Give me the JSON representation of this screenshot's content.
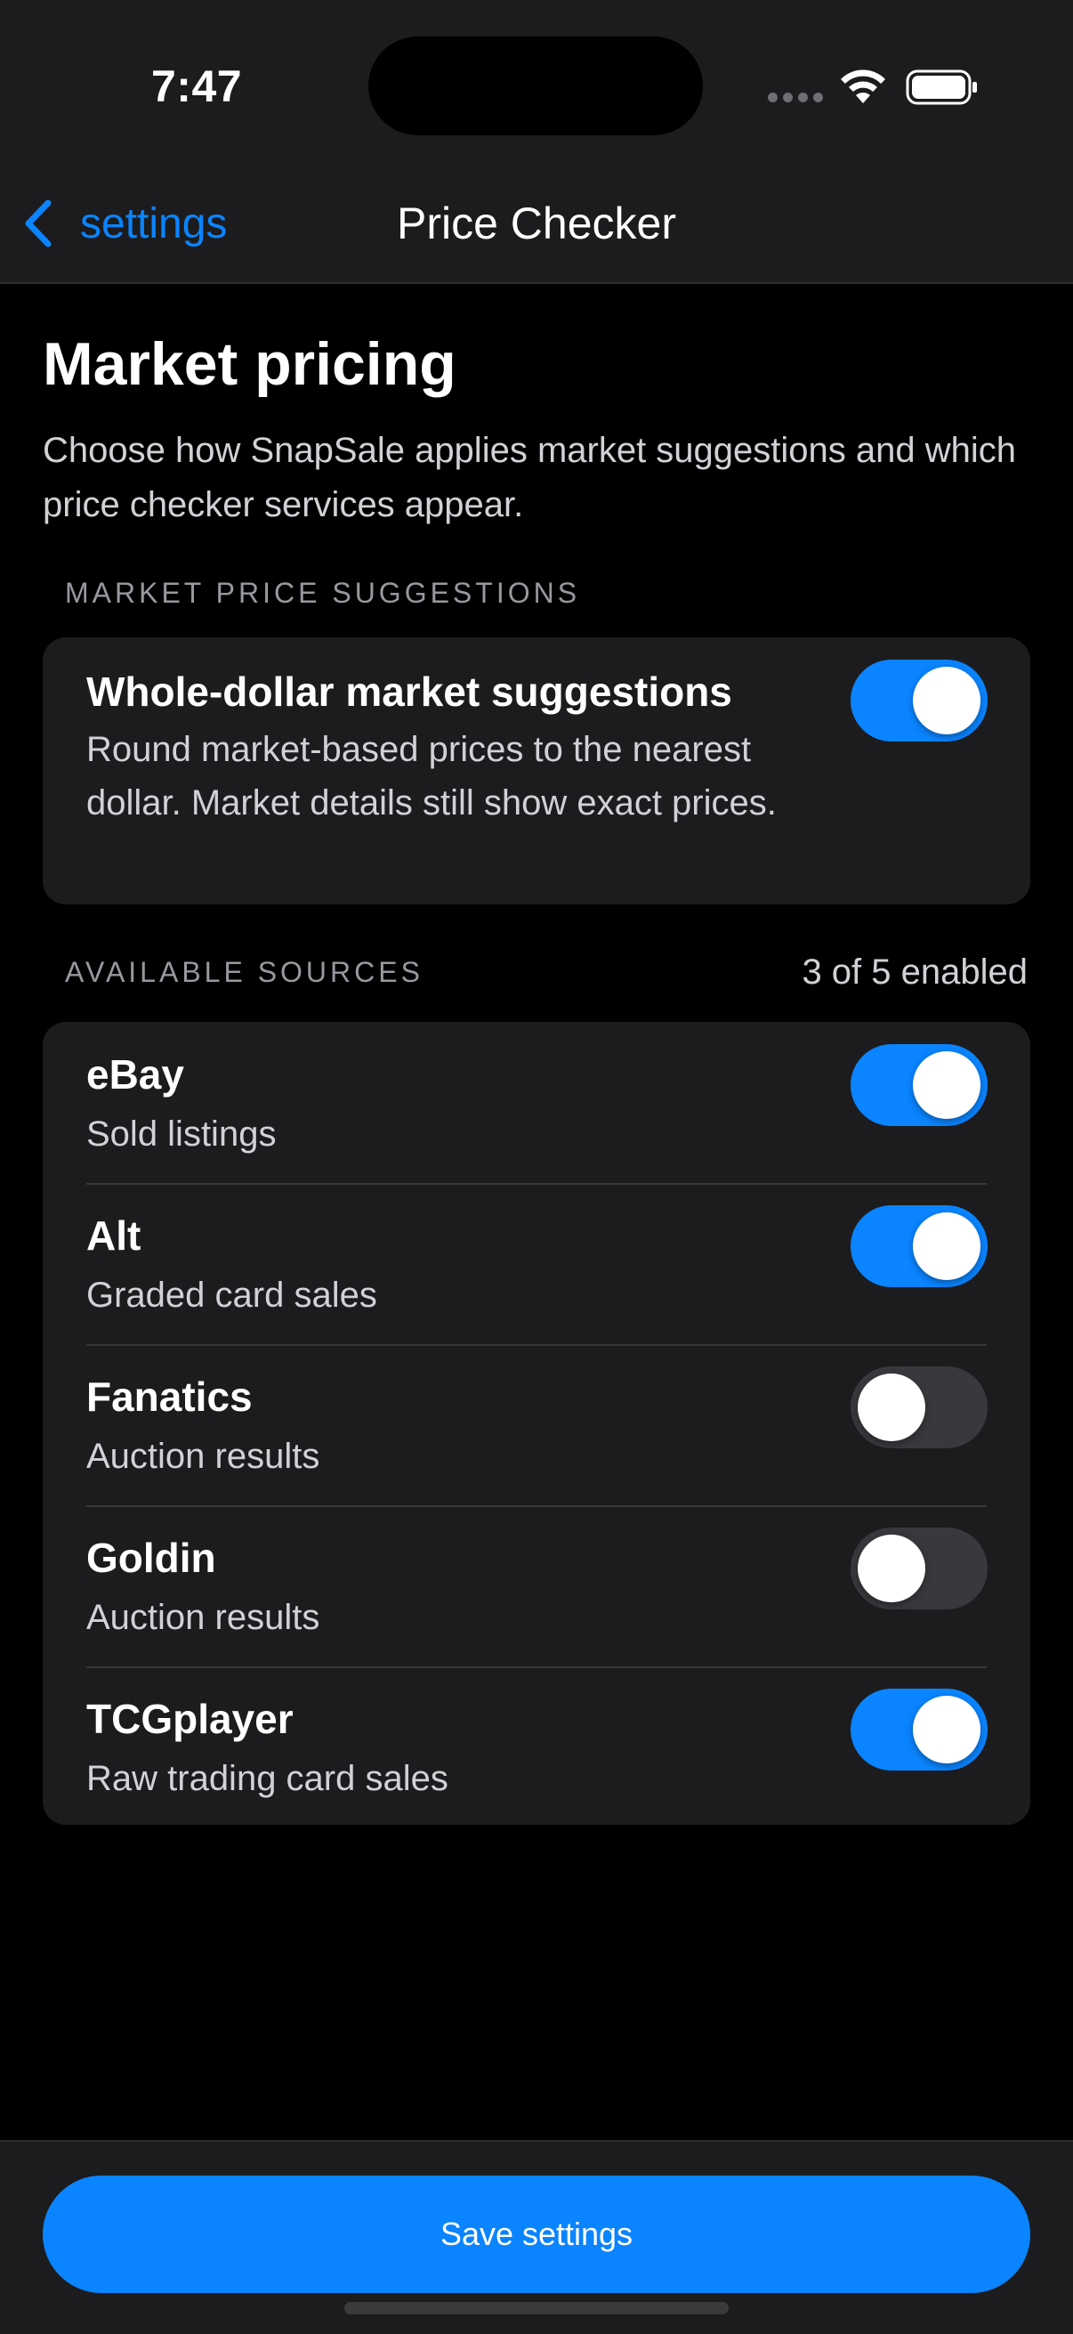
{
  "status_bar": {
    "time": "7:47"
  },
  "nav": {
    "back_label": "settings",
    "title": "Price Checker"
  },
  "page": {
    "title": "Market pricing",
    "description": "Choose how SnapSale applies market suggestions and which price checker services appear."
  },
  "suggestions": {
    "header": "MARKET PRICE SUGGESTIONS",
    "title": "Whole-dollar market suggestions",
    "subtitle": "Round market-based prices to the nearest dollar. Market details still show exact prices.",
    "enabled": true
  },
  "sources": {
    "header": "AVAILABLE SOURCES",
    "count": "3 of 5 enabled",
    "items": [
      {
        "name": "eBay",
        "desc": "Sold listings",
        "enabled": true
      },
      {
        "name": "Alt",
        "desc": "Graded card sales",
        "enabled": true
      },
      {
        "name": "Fanatics",
        "desc": "Auction results",
        "enabled": false
      },
      {
        "name": "Goldin",
        "desc": "Auction results",
        "enabled": false
      },
      {
        "name": "TCGplayer",
        "desc": "Raw trading card sales",
        "enabled": true
      }
    ]
  },
  "footer": {
    "save_label": "Save settings"
  },
  "colors": {
    "accent": "#0a84ff",
    "card": "#1c1c1e",
    "toggle_off": "#39393d"
  }
}
